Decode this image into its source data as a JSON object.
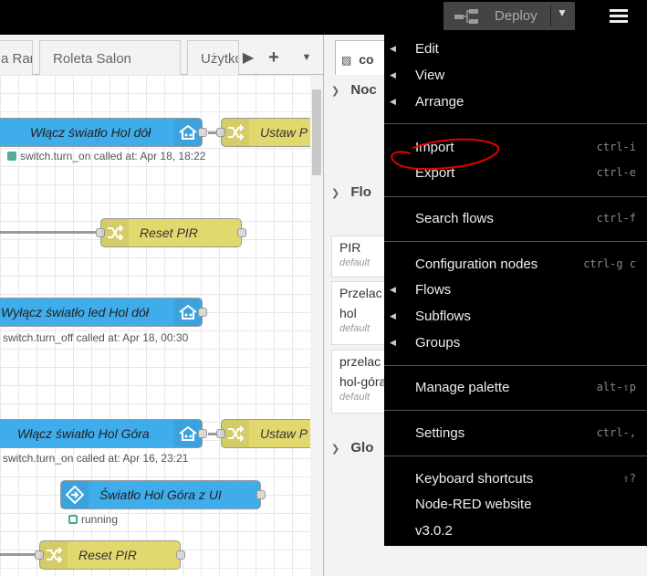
{
  "header": {
    "deploy_label": "Deploy"
  },
  "tabs": [
    {
      "label": "a Rar"
    },
    {
      "label": "Roleta Salon"
    },
    {
      "label": "Użytkc"
    }
  ],
  "canvas": {
    "nodes": [
      {
        "label": "Włącz światło Hol dół",
        "type": "service",
        "status": "switch.turn_on called at: Apr 18, 18:22",
        "status_color": "#5a9"
      },
      {
        "label": "Ustaw P",
        "type": "change"
      },
      {
        "label": "Reset PIR",
        "type": "change"
      },
      {
        "label": "Wyłącz światło led Hol dół",
        "type": "service",
        "status": "switch.turn_off called at: Apr 18, 00:30"
      },
      {
        "label": "Włącz światło Hol Góra",
        "type": "service",
        "status": "switch.turn_on called at: Apr 16, 23:21"
      },
      {
        "label": "Ustaw P",
        "type": "change"
      },
      {
        "label": "Światło Hol Góra z UI",
        "type": "input",
        "status": "running",
        "status_color": "#4a8"
      },
      {
        "label": "Reset PIR",
        "type": "change"
      }
    ]
  },
  "sidebar": {
    "tab_label": "co",
    "sections": [
      {
        "title": "Noc"
      },
      {
        "title": "Flo"
      },
      {
        "title": "Glo"
      }
    ],
    "items": [
      {
        "name": "PIR",
        "sub": "default"
      },
      {
        "name": "Przelac",
        "name2": "hol",
        "sub": "default"
      },
      {
        "name": "przelac",
        "name2": "hol-góra",
        "sub": "default"
      }
    ]
  },
  "menu": {
    "groups": [
      [
        {
          "label": "Edit",
          "submenu": true
        },
        {
          "label": "View",
          "submenu": true
        },
        {
          "label": "Arrange",
          "submenu": true
        }
      ],
      [
        {
          "label": "Import",
          "shortcut": "ctrl-i"
        },
        {
          "label": "Export",
          "shortcut": "ctrl-e"
        }
      ],
      [
        {
          "label": "Search flows",
          "shortcut": "ctrl-f"
        }
      ],
      [
        {
          "label": "Configuration nodes",
          "shortcut": "ctrl-g c"
        },
        {
          "label": "Flows",
          "submenu": true
        },
        {
          "label": "Subflows",
          "submenu": true
        },
        {
          "label": "Groups",
          "submenu": true
        }
      ],
      [
        {
          "label": "Manage palette",
          "shortcut": "alt-⇧p"
        }
      ],
      [
        {
          "label": "Settings",
          "shortcut": "ctrl-,"
        }
      ],
      [
        {
          "label": "Keyboard shortcuts",
          "shortcut": "⇧?"
        },
        {
          "label": "Node-RED website"
        },
        {
          "label": "v3.0.2"
        }
      ]
    ]
  },
  "colors": {
    "service_node": "#3fadeb",
    "change_node": "#e2d96e",
    "annotation": "#e00000"
  }
}
